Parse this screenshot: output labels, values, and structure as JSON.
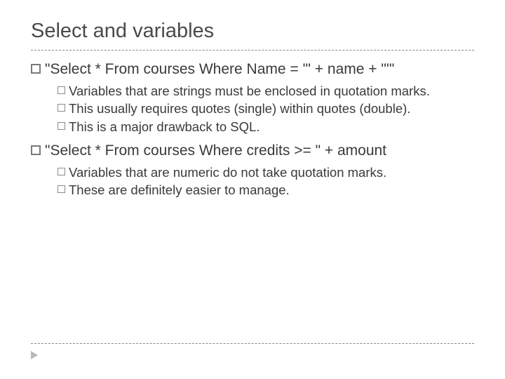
{
  "slide": {
    "title": "Select and variables",
    "items": [
      {
        "text": "\"Select * From courses Where Name = '\" + name + \"'\"",
        "subs": [
          {
            "text": "Variables that are strings must be enclosed in quotation marks."
          },
          {
            "text": "This usually requires quotes (single) within quotes (double)."
          },
          {
            "text": "This is a major drawback to SQL."
          }
        ]
      },
      {
        "text": "\"Select * From courses Where credits >= \" + amount",
        "subs": [
          {
            "text": "Variables that are numeric do not take quotation marks."
          },
          {
            "text": "These are definitely easier to manage."
          }
        ]
      }
    ]
  }
}
